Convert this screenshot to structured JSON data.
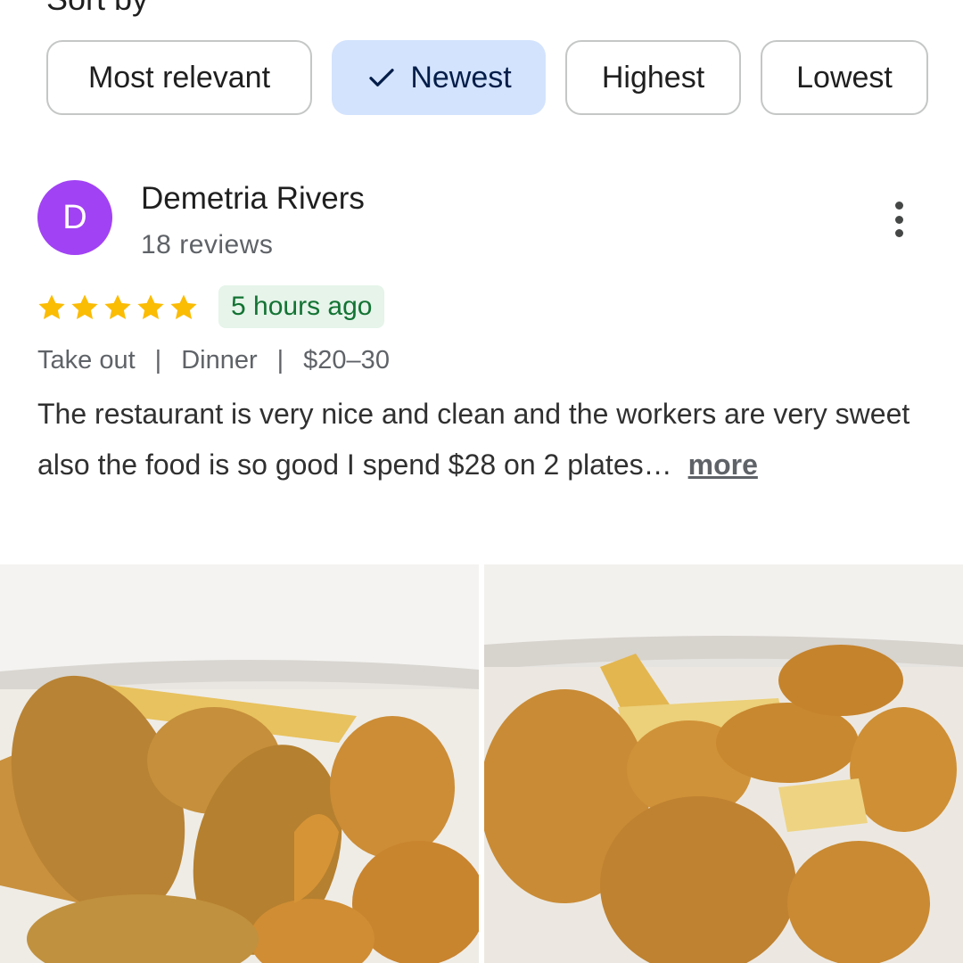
{
  "header": {
    "title": "Sort by"
  },
  "sort_options": [
    {
      "label": "Most relevant",
      "selected": false
    },
    {
      "label": "Newest",
      "selected": true
    },
    {
      "label": "Highest",
      "selected": false
    },
    {
      "label": "Lowest",
      "selected": false
    }
  ],
  "review": {
    "avatar_initial": "D",
    "avatar_color": "#a142f4",
    "name": "Demetria Rivers",
    "review_count": "18 reviews",
    "rating": 5,
    "star_color": "#fbbc04",
    "time_ago": "5 hours ago",
    "service": "Take out",
    "meal": "Dinner",
    "price": "$20–30",
    "separator": "|",
    "text": "The restaurant is very nice and clean and the workers are very sweet also the food is so good I spend $28 on 2 plates…",
    "more_label": "more",
    "menu_icon": "more-vert-icon"
  },
  "photos": [
    {
      "name": "photo-fried-fish-shrimp-1"
    },
    {
      "name": "photo-fried-fish-shrimp-2"
    }
  ],
  "colors": {
    "selected_chip_bg": "#d3e3fd",
    "time_badge_bg": "#e6f4ea",
    "time_badge_text": "#137333"
  }
}
